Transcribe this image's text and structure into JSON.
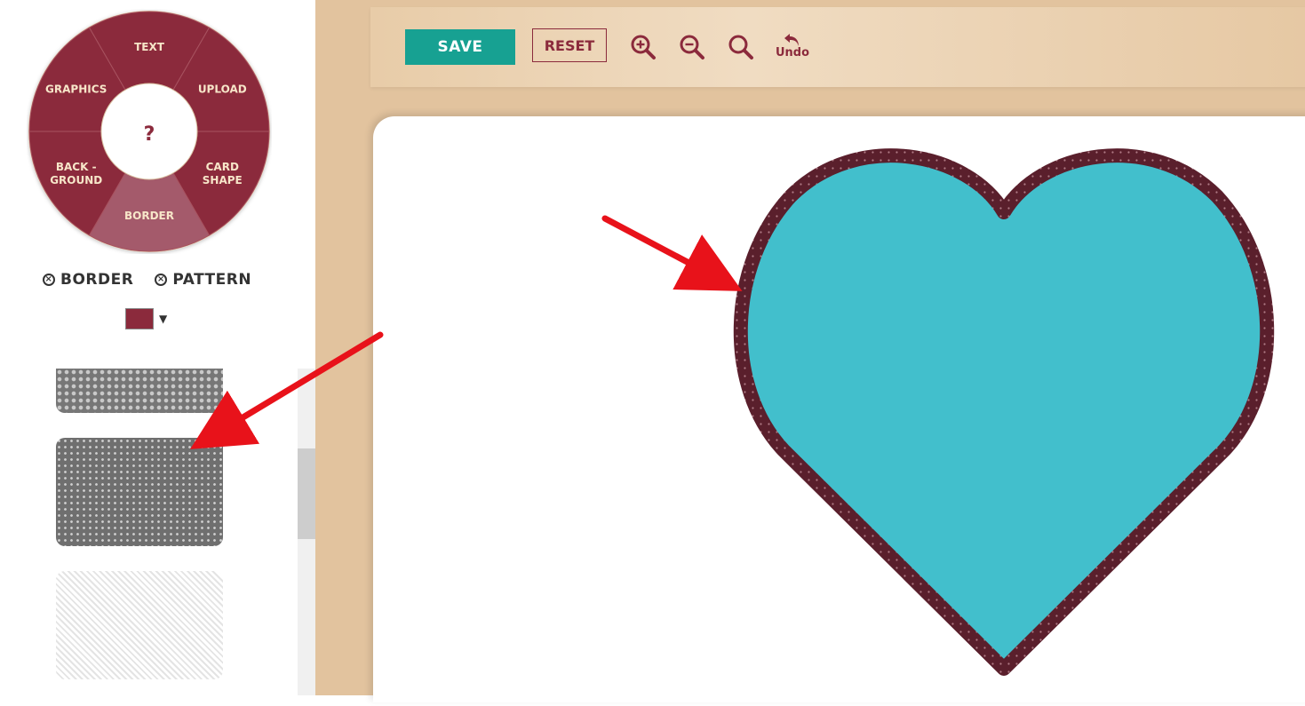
{
  "wheel": {
    "segments": [
      {
        "label_lines": [
          "TEXT"
        ]
      },
      {
        "label_lines": [
          "UPLOAD"
        ]
      },
      {
        "label_lines": [
          "CARD",
          "SHAPE"
        ]
      },
      {
        "label_lines": [
          "BORDER"
        ]
      },
      {
        "label_lines": [
          "BACK -",
          "GROUND"
        ]
      },
      {
        "label_lines": [
          "GRAPHICS"
        ]
      }
    ],
    "center_label": "?",
    "selected": "BORDER"
  },
  "toggles": {
    "border_label": "BORDER",
    "pattern_label": "PATTERN"
  },
  "color_picker": {
    "caret": "▼"
  },
  "pattern_list": {
    "tiles": [
      "dots-large",
      "dots-small-dense",
      "diagonal-stripes"
    ],
    "selected_index": 1
  },
  "toolbar": {
    "save_label": "SAVE",
    "reset_label": "RESET",
    "undo_label": "Undo",
    "icons": [
      "zoom-in-icon",
      "zoom-out-icon",
      "zoom-fit-icon",
      "undo-icon"
    ]
  },
  "colors": {
    "brand": "#8b2a3c",
    "save": "#17a192",
    "border_color": "#8b2a3c",
    "heart_fill": "#42bfcc",
    "heart_border": "#5a1f2c",
    "annotation_arrow": "#e8121a",
    "workspace": "#e2c39e"
  }
}
